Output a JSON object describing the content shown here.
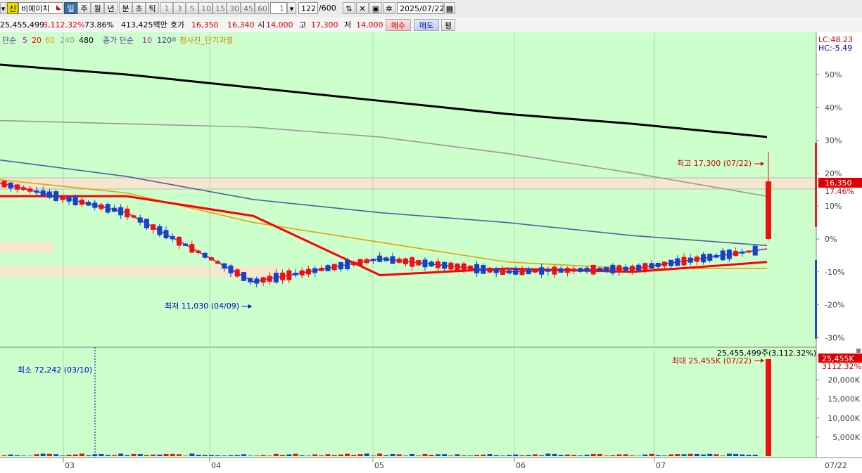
{
  "toolbar": {
    "sin_badge": "신",
    "stock_name": "비에이치",
    "periods": [
      "일",
      "주",
      "월",
      "년",
      "분",
      "초",
      "틱"
    ],
    "active_period": "일",
    "intervals": [
      "1",
      "3",
      "5",
      "10",
      "15",
      "30",
      "45",
      "60"
    ],
    "interval_value": "1",
    "count_value": "122",
    "count_total": "/600",
    "date_value": "2025/07/22",
    "calendar_icon": "calendar-icon",
    "settings_icon": "gear-icon",
    "save_icon": "save-icon"
  },
  "quote": {
    "volume": "25,455,499",
    "volume_rate": "3,112.32%",
    "turnover": "73.86%",
    "amount": "413,425백만",
    "hoga_label": "호가",
    "ask": "16,350",
    "bid": "16,340",
    "open_label": "시",
    "open": "14,000",
    "high_label": "고",
    "high": "17,300",
    "low_label": "저",
    "low": "14,000",
    "buy_label": "매수",
    "sell_label": "매도",
    "avg_label": "평"
  },
  "legend": {
    "simple_label": "단순",
    "ma_periods": [
      "5",
      "20",
      "60",
      "240",
      "480"
    ],
    "ma_colors": [
      "#d000d0",
      "#ff0000",
      "#e8a000",
      "#999999",
      "#000000"
    ],
    "close_simple_label": "종가 단순",
    "close_ma_periods": [
      "10",
      "120"
    ],
    "close_ma_colors": [
      "#b0269b",
      "#4040a0"
    ],
    "signal_label": "청사진_단기과열"
  },
  "corner": {
    "lc": "LC:48.23",
    "hc": "HC:-5.49"
  },
  "chart_data": {
    "type": "candlestick",
    "x_ticks": [
      "03",
      "04",
      "05",
      "06",
      "07"
    ],
    "x_end_label": "07/22",
    "y_ticks_pct": [
      "50%",
      "40%",
      "30%",
      "20%",
      "10%",
      "0%",
      "-10%",
      "-20%",
      "-30%"
    ],
    "y_pct_range": [
      -32,
      55
    ],
    "last_price": "16,350",
    "last_pct": "17.46%",
    "high_annotation": "최고 17,300 (07/22)",
    "low_annotation": "최저 11,030 (04/09)",
    "high_price": 17300,
    "low_price": 11030,
    "ma_lines": [
      {
        "name": "480",
        "color": "#000000",
        "pct": [
          53,
          50,
          46,
          42,
          38,
          35,
          31
        ]
      },
      {
        "name": "240",
        "color": "#999999",
        "pct": [
          36,
          35,
          34,
          31,
          26,
          20,
          13
        ]
      },
      {
        "name": "120",
        "color": "#5a5aa0",
        "pct": [
          24,
          19,
          12,
          8,
          5,
          1,
          -2
        ]
      },
      {
        "name": "60",
        "color": "#e8a000",
        "pct": [
          18,
          14,
          5,
          -1,
          -7,
          -9,
          -9
        ]
      },
      {
        "name": "20",
        "color": "#ff0000",
        "pct": [
          13,
          13,
          7,
          -11,
          -9,
          -10,
          -7
        ]
      },
      {
        "name": "5",
        "color": "#d000d0",
        "pct": [
          17,
          8,
          -13,
          -6,
          -10,
          -9,
          -3
        ]
      }
    ],
    "volume_ticks": [
      "20,000K",
      "15,000K",
      "10,000K",
      "5,000K"
    ],
    "volume_range": [
      0,
      26000000
    ],
    "volume_last": 25455499,
    "volume_max_label": "25,455K",
    "volume_rate_label": "3112.32%",
    "volume_max_annotation": "최대 25,455K (07/22)",
    "volume_min_annotation": "최소 72,242 (03/10)",
    "volume_top_label": "25,455,499주(3,112.32%)"
  }
}
